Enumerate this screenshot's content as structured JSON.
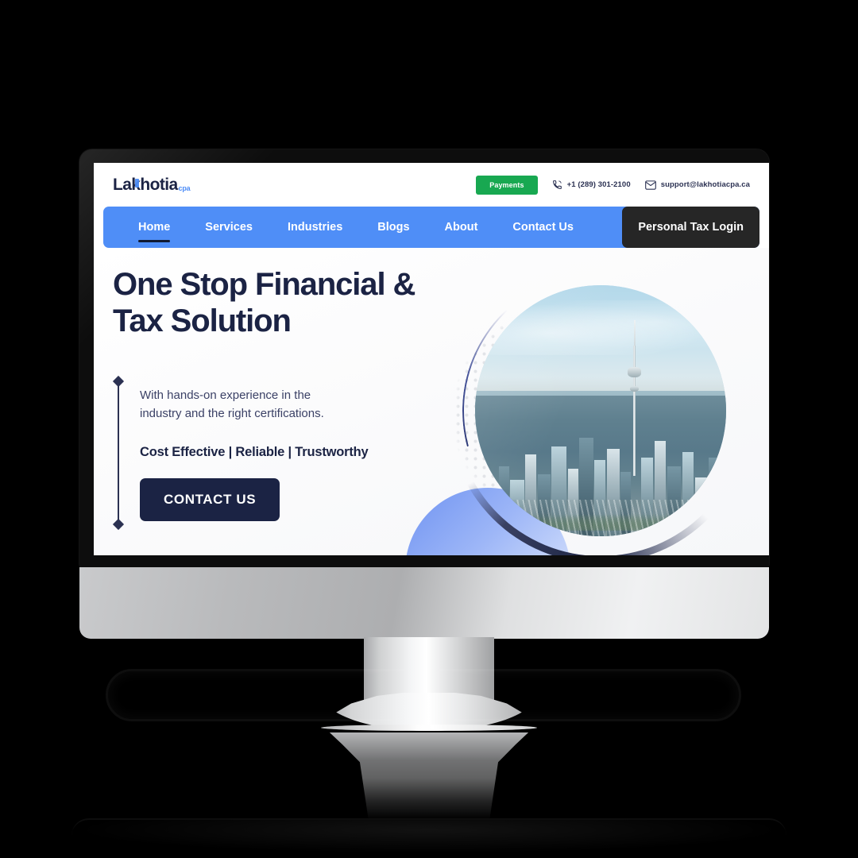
{
  "brand": {
    "logo_text": "Lakhotia",
    "logo_suffix": "cpa"
  },
  "topbar": {
    "payments_label": "Payments",
    "phone": "+1 (289) 301-2100",
    "email": "support@lakhotiacpa.ca",
    "phone_icon": "phone-icon",
    "email_icon": "envelope-icon",
    "payments_color": "#18a851"
  },
  "nav": {
    "items": [
      {
        "label": "Home",
        "active": true
      },
      {
        "label": "Services",
        "active": false
      },
      {
        "label": "Industries",
        "active": false
      },
      {
        "label": "Blogs",
        "active": false
      },
      {
        "label": "About",
        "active": false
      },
      {
        "label": "Contact Us",
        "active": false
      }
    ],
    "login_label": "Personal Tax Login",
    "bar_color": "#4f8ef7",
    "login_color": "#262626"
  },
  "hero": {
    "title_line1": "One Stop Financial &",
    "title_line2": "Tax Solution",
    "subtitle_line1": "With hands-on experience in the",
    "subtitle_line2": "industry and the right certifications.",
    "tagline": "Cost Effective | Reliable | Trustworthy",
    "cta_label": "CONTACT US",
    "title_color": "#1b2344",
    "cta_color": "#1b2344",
    "image_alt": "toronto-skyline-photo"
  },
  "device": {
    "type": "desktop-monitor",
    "bezel_color": "#0d0d0d",
    "chin_color": "#c9cacc",
    "background_color": "#000000"
  }
}
